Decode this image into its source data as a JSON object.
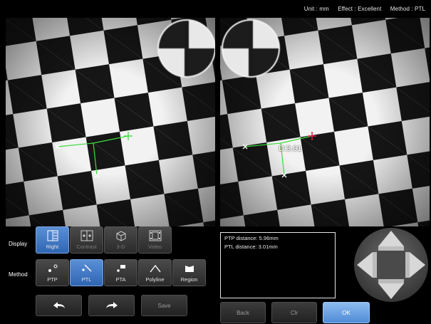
{
  "status": {
    "unit": "Unit : mm",
    "effect": "Effect : Excellent",
    "method": "Method : PTL"
  },
  "overlay": {
    "distance_label": "D:3.01",
    "line_color": "#3ddc3d",
    "cursor_color": "#e01c4a"
  },
  "controls": {
    "display_label": "Display",
    "method_label": "Method",
    "display_buttons": [
      {
        "label": "Right",
        "active": true
      },
      {
        "label": "Contrast",
        "active": false
      },
      {
        "label": "3-D",
        "active": false
      },
      {
        "label": "Video",
        "active": false
      }
    ],
    "method_buttons": [
      {
        "label": "PTP",
        "active": false
      },
      {
        "label": "PTL",
        "active": true
      },
      {
        "label": "PTA",
        "active": false
      },
      {
        "label": "Polyline",
        "active": false
      },
      {
        "label": "Region",
        "active": false
      }
    ],
    "save_label": "Save"
  },
  "results": {
    "ptp": "PTP distance: 5.96mm",
    "ptl": "PTL distance: 3.01mm"
  },
  "footer": {
    "back": "Back",
    "clr": "Clr",
    "ok": "OK"
  },
  "colors": {
    "accent": "#3f79c9",
    "ok_button": "#6fa6e6"
  }
}
